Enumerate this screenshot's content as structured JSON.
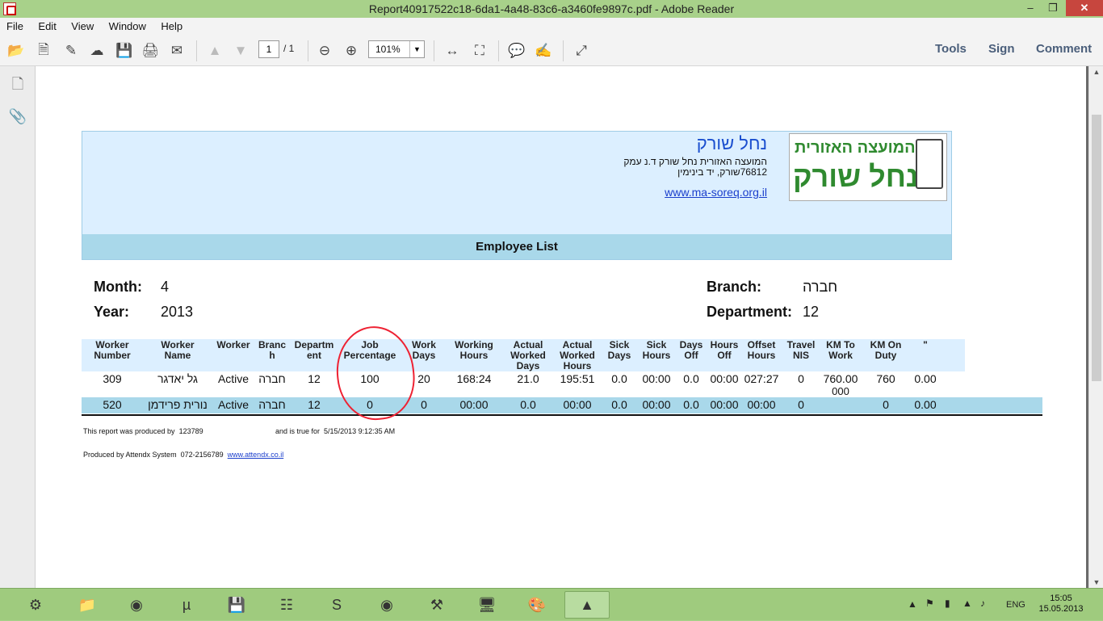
{
  "window": {
    "title": "Report40917522c18-6da1-4a48-83c6-a3460fe9897c.pdf - Adobe Reader"
  },
  "menu": [
    "File",
    "Edit",
    "View",
    "Window",
    "Help"
  ],
  "toolbar": {
    "page_current": "1",
    "page_total": "/ 1",
    "zoom": "101%",
    "tools": "Tools",
    "sign": "Sign",
    "comment": "Comment"
  },
  "report": {
    "org_name": "נחל שורק",
    "address_line1": "המועצה האזורית נחל שורק ד.נ עמק",
    "address_line2": "76812שורק, יד בינימין",
    "url": "www.ma-soreq.org.il",
    "logo_line1": "המועצה האזורית",
    "logo_line2": "נחל שורק",
    "title": "Employee List",
    "month_label": "Month:",
    "month_value": "4",
    "year_label": "Year:",
    "year_value": "2013",
    "branch_label": "Branch:",
    "branch_value": "חברה",
    "department_label": "Department:",
    "department_value": "12"
  },
  "table": {
    "headers": [
      "Worker\nNumber",
      "Worker\nName",
      "Worker",
      "Branc\nh",
      "Departm\nent",
      "Job\nPercentage",
      "Work\nDays",
      "Working\nHours",
      "Actual\nWorked\nDays",
      "Actual\nWorked\nHours",
      "Sick\nDays",
      "Sick\nHours",
      "Days\nOff",
      "Hours\nOff",
      "Offset\nHours",
      "Travel\nNIS",
      "KM To\nWork",
      "KM On\nDuty",
      "\""
    ],
    "rows": [
      [
        "309",
        "גל יאדגר",
        "Active",
        "חברה",
        "12",
        "100",
        "20",
        "168:24",
        "21.0",
        "195:51",
        "0.0",
        "00:00",
        "0.0",
        "00:00",
        "027:27",
        "0",
        "760.00\n000",
        "760",
        "0.00"
      ],
      [
        "520",
        "נורית פרידמן",
        "Active",
        "חברה",
        "12",
        "0",
        "0",
        "00:00",
        "0.0",
        "00:00",
        "0.0",
        "00:00",
        "0.0",
        "00:00",
        "00:00",
        "0",
        "",
        "0",
        "0.00"
      ]
    ]
  },
  "footer": {
    "produced_by_text": "This report was produced by",
    "produced_by_id": "123789",
    "true_for_text": "and is true for",
    "true_for_date": "5/15/2013 9:12:35 AM",
    "system_text": "Produced by Attendx System",
    "system_phone": "072-2156789",
    "system_url": "www.attendx.co.il"
  },
  "tray": {
    "lang": "ENG",
    "time": "15:05",
    "date": "15.05.2013"
  }
}
